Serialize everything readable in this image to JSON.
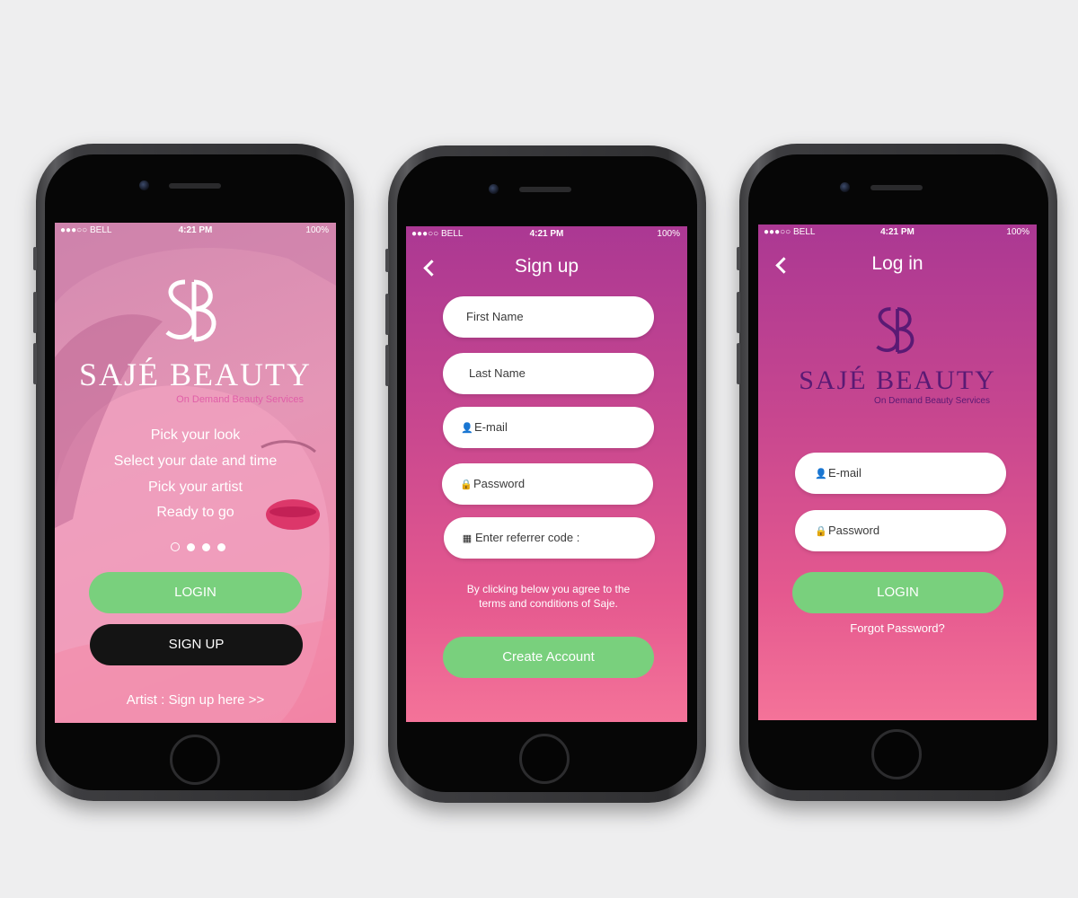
{
  "status_bar": {
    "carrier": "●●●○○ BELL",
    "time": "4:21 PM",
    "battery": "100%"
  },
  "welcome": {
    "brand": "SAJÉ BEAUTY",
    "tagline": "On Demand Beauty Services",
    "taglines": [
      "Pick your look",
      "Select your date and time",
      "Pick your artist",
      "Ready to go"
    ],
    "login_label": "LOGIN",
    "signup_label": "SIGN UP",
    "artist_link": "Artist : Sign up here >>",
    "carousel_pages": 4,
    "carousel_active": 0
  },
  "signup": {
    "title": "Sign up",
    "first_name_placeholder": "First Name",
    "last_name_placeholder": "Last Name",
    "email_placeholder": "E-mail",
    "password_placeholder": "Password",
    "referrer_placeholder": "Enter referrer code :",
    "terms_text": "By clicking below you agree to the terms and conditions of Saje.",
    "create_label": "Create Account"
  },
  "login": {
    "title": "Log in",
    "brand": "SAJÉ BEAUTY",
    "tagline": "On Demand Beauty Services",
    "email_placeholder": "E-mail",
    "password_placeholder": "Password",
    "login_label": "LOGIN",
    "forgot_label": "Forgot Password?"
  },
  "icons": {
    "user": "user-icon",
    "lock": "lock-icon",
    "qr": "qr-code-icon",
    "back": "chevron-left-icon",
    "wifi": "wifi-icon",
    "bluetooth": "bluetooth-icon",
    "battery": "battery-icon"
  },
  "colors": {
    "pink_top": "#a8378f",
    "pink_bottom": "#f67199",
    "button_green": "#79d07d",
    "button_black": "#141414",
    "logo_purple": "#5a1a74"
  }
}
